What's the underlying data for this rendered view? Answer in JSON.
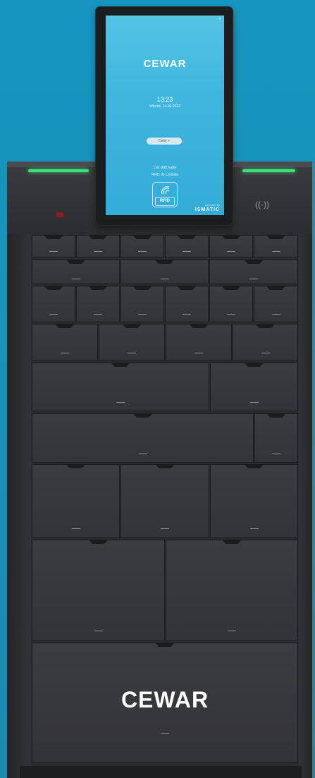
{
  "screen": {
    "close_glyph": "×",
    "logo": "CEWAR",
    "time": "13:23",
    "date": "Wtorek, 14.06.2022",
    "button_label": "Dalej >",
    "message_line1": "Lub zbliż kartę",
    "message_line2": "RFID do czytnika",
    "rfid_label": "RFID",
    "powered_by": "powered by",
    "vendor": "ISMATIC"
  },
  "cabinet": {
    "logo": "CEWAR",
    "indicator_color": "#3ee07a",
    "red_indicator_color": "#8c1e1e",
    "reader_icon": "((·))"
  },
  "colors": {
    "background": "#1596bf",
    "body": "#2a2b2d",
    "logo_accent": "#4cc3e9"
  }
}
